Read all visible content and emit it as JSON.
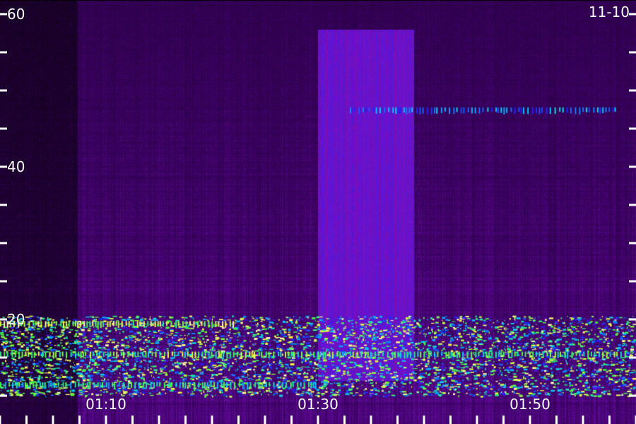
{
  "chart_data": {
    "type": "heatmap",
    "title": "",
    "date_label": "11-10",
    "xlabel": "",
    "ylabel": "",
    "x_tick_labels": [
      "01:10",
      "01:30",
      "01:50"
    ],
    "y_tick_labels": [
      "20",
      "40",
      "60"
    ],
    "ylim": [
      10,
      60
    ],
    "xlim_minutes": [
      "01:00",
      "02:00"
    ],
    "colormap": [
      "#000000",
      "#3a0060",
      "#7a10c0",
      "#2020ff",
      "#00d0ff",
      "#40ff40",
      "#ffff40",
      "#ffffff"
    ],
    "background": "#000000",
    "features": [
      {
        "name": "broadband enhancement",
        "x_range": [
          "01:30",
          "01:39"
        ],
        "y_range": [
          12,
          58
        ],
        "level": 0.35
      },
      {
        "name": "pulsed band",
        "x_range": [
          "01:00",
          "01:22"
        ],
        "y_center": 19.5,
        "level": 0.95
      },
      {
        "name": "pulsed band",
        "x_range": [
          "01:00",
          "01:30"
        ],
        "y_center": 15.5,
        "level": 0.85
      },
      {
        "name": "pulsed band",
        "x_range": [
          "01:30",
          "01:59"
        ],
        "y_center": 15.5,
        "level": 0.8
      },
      {
        "name": "pulsed band",
        "x_range": [
          "01:00",
          "01:30"
        ],
        "y_center": 11.5,
        "level": 0.75
      },
      {
        "name": "weak tones",
        "x_range": [
          "01:33",
          "01:58"
        ],
        "y_center": 47.5,
        "level": 0.6
      }
    ]
  }
}
